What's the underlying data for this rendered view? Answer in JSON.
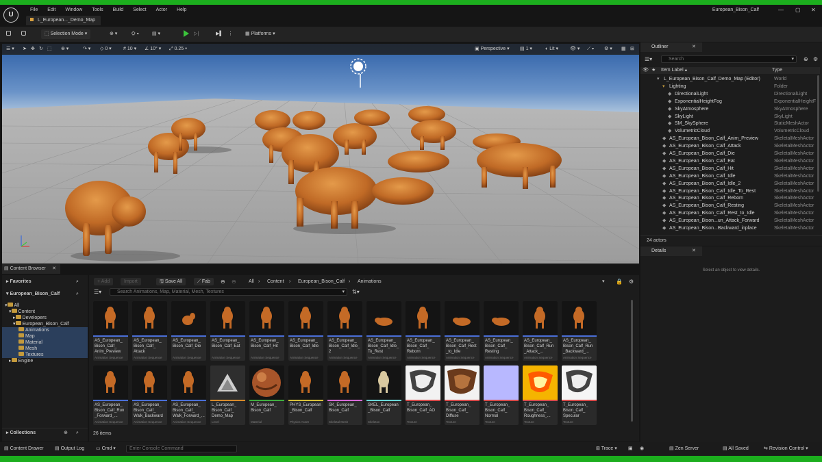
{
  "window": {
    "title": "European_Bison_Calf",
    "map_tab": "L_European..._Demo_Map",
    "minimize": "—",
    "maximize": "▢",
    "close": "✕"
  },
  "menu": [
    "File",
    "Edit",
    "Window",
    "Tools",
    "Build",
    "Select",
    "Actor",
    "Help"
  ],
  "toolbar": {
    "selection_mode": "Selection Mode",
    "platforms": "Platforms"
  },
  "viewport": {
    "rot_snap": "0",
    "grid_snap": "10",
    "angle_snap": "10°",
    "scale_snap": "0.25",
    "perspective": "Perspective",
    "lit": "Lit",
    "camera_speed": "1"
  },
  "outliner": {
    "title": "Outliner",
    "search_placeholder": "Search",
    "col_label": "Item Label ▴",
    "col_type": "Type",
    "rows": [
      {
        "label": "L_European_Bison_Calf_Demo_Map (Editor)",
        "type": "World"
      },
      {
        "label": "Lighting",
        "type": "Folder"
      },
      {
        "label": "DirectionalLight",
        "type": "DirectionalLight"
      },
      {
        "label": "ExponentialHeightFog",
        "type": "ExponentialHeightF"
      },
      {
        "label": "SkyAtmosphere",
        "type": "SkyAtmosphere"
      },
      {
        "label": "SkyLight",
        "type": "SkyLight"
      },
      {
        "label": "SM_SkySphere",
        "type": "StaticMeshActor"
      },
      {
        "label": "VolumetricCloud",
        "type": "VolumetricCloud"
      },
      {
        "label": "AS_European_Bison_Calf_Anim_Preview",
        "type": "SkeletalMeshActor"
      },
      {
        "label": "AS_European_Bison_Calf_Attack",
        "type": "SkeletalMeshActor"
      },
      {
        "label": "AS_European_Bison_Calf_Die",
        "type": "SkeletalMeshActor"
      },
      {
        "label": "AS_European_Bison_Calf_Eat",
        "type": "SkeletalMeshActor"
      },
      {
        "label": "AS_European_Bison_Calf_Hit",
        "type": "SkeletalMeshActor"
      },
      {
        "label": "AS_European_Bison_Calf_Idle",
        "type": "SkeletalMeshActor"
      },
      {
        "label": "AS_European_Bison_Calf_Idle_2",
        "type": "SkeletalMeshActor"
      },
      {
        "label": "AS_European_Bison_Calf_Idle_To_Rest",
        "type": "SkeletalMeshActor"
      },
      {
        "label": "AS_European_Bison_Calf_Reborn",
        "type": "SkeletalMeshActor"
      },
      {
        "label": "AS_European_Bison_Calf_Resting",
        "type": "SkeletalMeshActor"
      },
      {
        "label": "AS_European_Bison_Calf_Rest_to_Idle",
        "type": "SkeletalMeshActor"
      },
      {
        "label": "AS_European_Bison...un_Attack_Forward",
        "type": "SkeletalMeshActor"
      },
      {
        "label": "AS_European_Bison...Backward_inplace",
        "type": "SkeletalMeshActor"
      }
    ],
    "count": "24 actors"
  },
  "details": {
    "title": "Details",
    "empty": "Select an object to view details."
  },
  "content_browser": {
    "tab": "Content Browser",
    "favorites": "Favorites",
    "project": "European_Bison_Calf",
    "tree": [
      "All",
      "Content",
      "Developers",
      "European_Bison_Calf",
      "Animations",
      "Map",
      "Material",
      "Mesh",
      "Textures",
      "Engine"
    ],
    "collections": "Collections",
    "add": "+ Add",
    "import": "Import",
    "save_all": "Save All",
    "fab": "Fab",
    "path": [
      "All",
      "Content",
      "European_Bison_Calf",
      "Animations"
    ],
    "search_placeholder": "Search Animations, Map, Material, Mesh, Textures",
    "item_count": "26 items",
    "assets": [
      {
        "name": "AS_European_\nBison_Calf_\nAnim_Preview",
        "type": "Animation Sequence",
        "kind": "anim"
      },
      {
        "name": "AS_European_\nBison_Calf_\nAttack",
        "type": "Animation Sequence",
        "kind": "anim"
      },
      {
        "name": "AS_European_\nBison_Calf_Die",
        "type": "Animation Sequence",
        "kind": "anim"
      },
      {
        "name": "AS_European_\nBison_Calf_Eat",
        "type": "Animation Sequence",
        "kind": "anim"
      },
      {
        "name": "AS_European_\nBison_Calf_Hit",
        "type": "Animation Sequence",
        "kind": "anim"
      },
      {
        "name": "AS_European_\nBison_Calf_Idle",
        "type": "Animation Sequence",
        "kind": "anim"
      },
      {
        "name": "AS_European_\nBison_Calf_Idle_\n2",
        "type": "Animation Sequence",
        "kind": "anim"
      },
      {
        "name": "AS_European_\nBison_Calf_Idle_\nTo_Rest",
        "type": "Animation Sequence",
        "kind": "anim"
      },
      {
        "name": "AS_European_\nBison_Calf_\nReborn",
        "type": "Animation Sequence",
        "kind": "anim"
      },
      {
        "name": "AS_European_\nBison_Calf_Rest\n_to_Idle",
        "type": "Animation Sequence",
        "kind": "anim"
      },
      {
        "name": "AS_European_\nBison_Calf_\nResting",
        "type": "Animation Sequence",
        "kind": "anim"
      },
      {
        "name": "AS_European_\nBison_Calf_Run\n_Attack_...",
        "type": "Animation Sequence",
        "kind": "anim"
      },
      {
        "name": "AS_European_\nBison_Calf_Run\n_Backward_...",
        "type": "Animation Sequence",
        "kind": "anim"
      },
      {
        "name": "AS_European_\nBison_Calf_Run\n_Forward_...",
        "type": "Animation Sequence",
        "kind": "anim"
      },
      {
        "name": "AS_European_\nBison_Calf_\nWalk_Backward",
        "type": "Animation Sequence",
        "kind": "anim"
      },
      {
        "name": "AS_European_\nBison_Calf_\nWalk_Forward_...",
        "type": "Animation Sequence",
        "kind": "anim"
      },
      {
        "name": "L_European_\nBison_Calf_\nDemo_Map",
        "type": "Level",
        "kind": "level"
      },
      {
        "name": "M_European_\nBison_Calf",
        "type": "Material",
        "kind": "material"
      },
      {
        "name": "PHYS_European\n_Bison_Calf",
        "type": "Physics Asset",
        "kind": "phys"
      },
      {
        "name": "SK_European_\nBison_Calf",
        "type": "Skeletal Mesh",
        "kind": "mesh"
      },
      {
        "name": "SKEL_European\n_Bison_Calf",
        "type": "Skeleton",
        "kind": "skel"
      },
      {
        "name": "T_European_\nBison_Calf_AO",
        "type": "Texture",
        "kind": "tex-ao"
      },
      {
        "name": "T_European_\nBison_Calf_\nDiffuse",
        "type": "Texture",
        "kind": "tex-diffuse"
      },
      {
        "name": "T_European_\nBison_Calf_\nNormal",
        "type": "Texture",
        "kind": "tex-normal"
      },
      {
        "name": "T_European_\nBison_Calf_\nRoughness_...",
        "type": "Texture",
        "kind": "tex-rough"
      },
      {
        "name": "T_European_\nBison_Calf_\nSpecular",
        "type": "Texture",
        "kind": "tex-spec"
      }
    ]
  },
  "statusbar": {
    "drawer": "Content Drawer",
    "output_log": "Output Log",
    "cmd": "Cmd",
    "console_placeholder": "Enter Console Command",
    "trace": "Trace",
    "zen": "Zen Server",
    "saved": "All Saved",
    "revision": "Revision Control"
  },
  "colors": {
    "accent_green": "#1cae1e",
    "selection_blue": "#2b3f5c",
    "folder": "#c49a3c",
    "anim_line": "#4a6fd8"
  }
}
